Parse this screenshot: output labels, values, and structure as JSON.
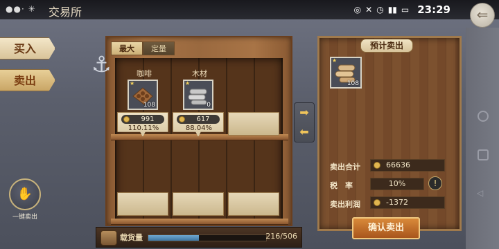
{
  "statusbar": {
    "title": "交易所",
    "clock": "23:29",
    "icons": [
      "notification-dots-icon",
      "bluetooth-icon",
      "mute-icon",
      "alarm-icon",
      "signal-icon",
      "battery-icon"
    ]
  },
  "side_tabs": {
    "buy": "买入",
    "sell": "卖出",
    "quick_sell": "一键卖出"
  },
  "shelf": {
    "tabs": [
      {
        "label": "最大",
        "active": true
      },
      {
        "label": "定量",
        "active": false
      }
    ],
    "goods": [
      {
        "name": "咖啡",
        "count": "108",
        "price": "991",
        "percent": "110.11%",
        "icon": "coffee-beans-icon"
      },
      {
        "name": "木材",
        "count": "0",
        "price": "617",
        "percent": "88.04%",
        "icon": "wood-logs-icon"
      }
    ]
  },
  "cargo": {
    "label": "载货量",
    "value": "216/506",
    "fill": 0.427
  },
  "right_panel": {
    "title": "预计卖出",
    "item_count": "108",
    "item_icon": "wood-logs-icon",
    "rows": [
      {
        "label": "卖出合计",
        "value": "66636"
      },
      {
        "label": "税　率",
        "value": "10%"
      },
      {
        "label": "卖出利润",
        "value": "-1372"
      }
    ],
    "confirm": "确认卖出"
  },
  "colors": {
    "accent": "#d98a3a",
    "panel_wood": "#74492a",
    "coin": "#e0b650"
  }
}
